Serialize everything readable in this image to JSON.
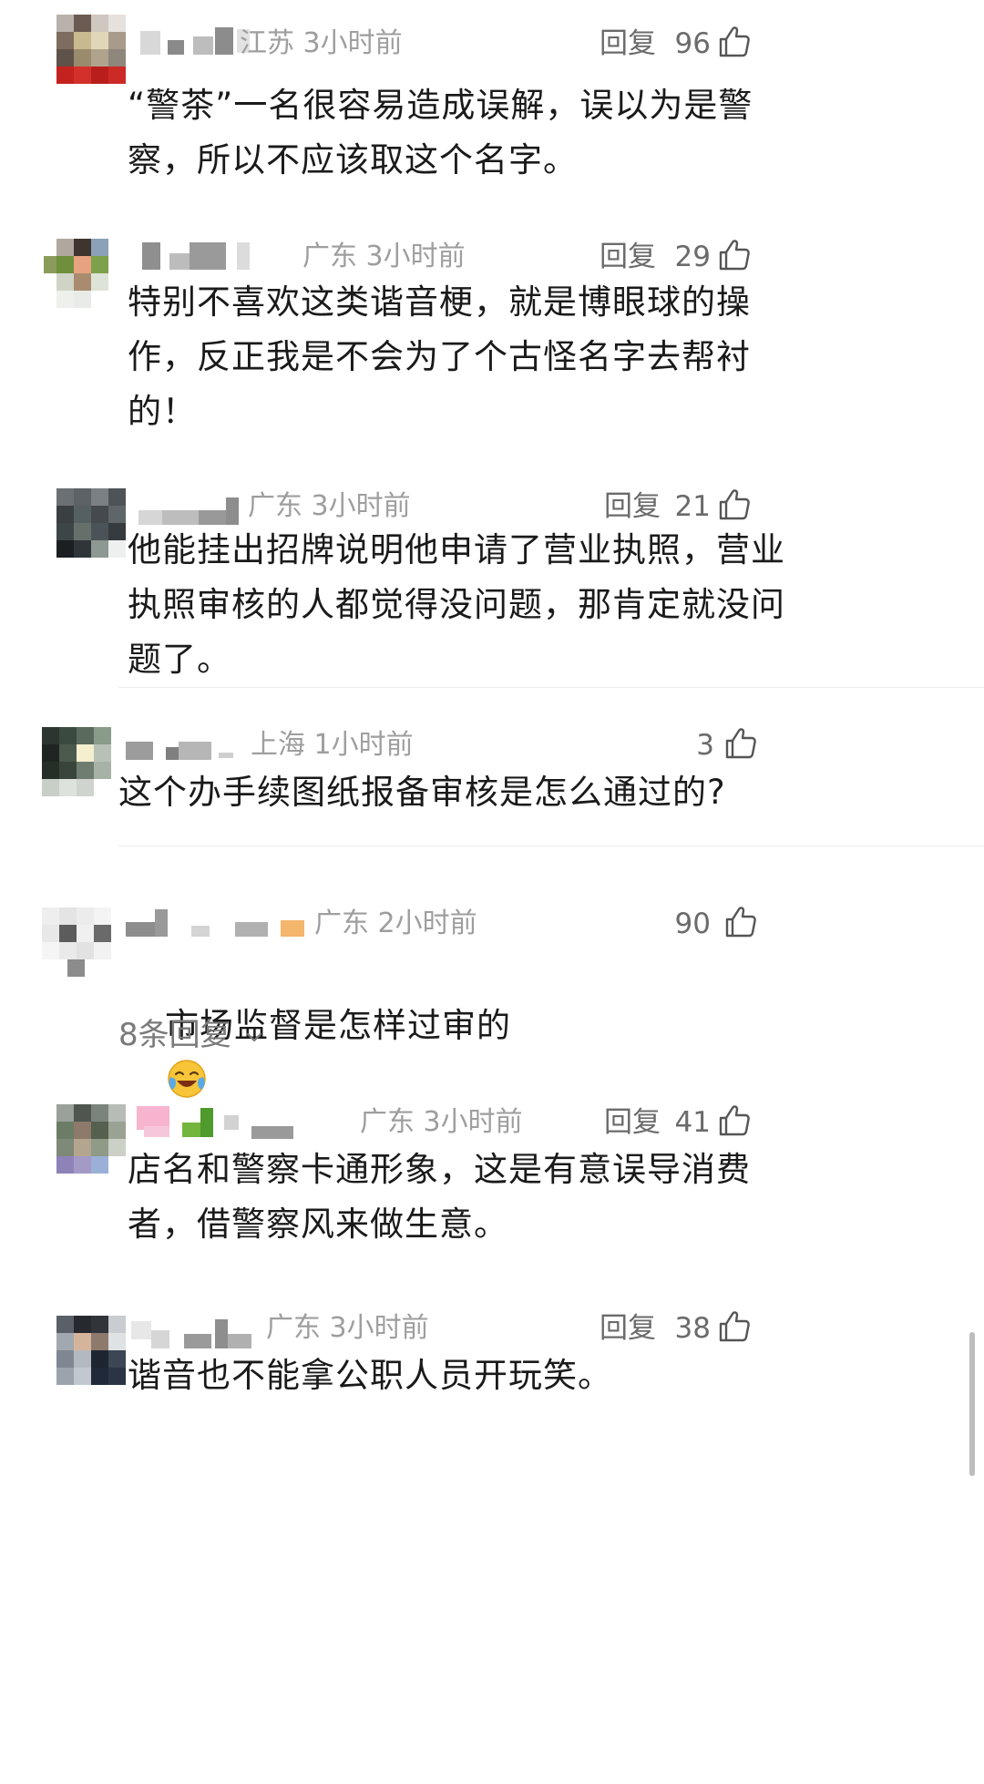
{
  "comments": [
    {
      "location_time": "江苏 3小时前",
      "reply_label": "回复",
      "likes": "96",
      "text": "“警茶”一名很容易造成误解，误以为是警\n察，所以不应该取这个名字。"
    },
    {
      "location_time": "广东 3小时前",
      "reply_label": "回复",
      "likes": "29",
      "text": "特别不喜欢这类谐音梗，就是博眼球的操\n作，反正我是不会为了个古怪名字去帮衬\n的！"
    },
    {
      "location_time": "广东 3小时前",
      "reply_label": "回复",
      "likes": "21",
      "text": "他能挂出招牌说明他申请了营业执照，营业\n执照审核的人都觉得没问题，那肯定就没问\n题了。"
    },
    {
      "location_time": "上海 1小时前",
      "likes": "3",
      "text": "这个办手续图纸报备审核是怎么通过的?"
    },
    {
      "location_time": "广东 2小时前",
      "likes": "90",
      "text": "市场监督是怎样过审的",
      "emoji": "face-with-tears-of-joy",
      "more_replies": "8条回复"
    },
    {
      "location_time": "广东 3小时前",
      "reply_label": "回复",
      "likes": "41",
      "text": "店名和警察卡通形象，这是有意误导消费\n者，借警察风来做生意。"
    },
    {
      "location_time": "广东 3小时前",
      "reply_label": "回复",
      "likes": "38",
      "text": "谐音也不能拿公职人员开玩笑。"
    }
  ],
  "colors": {
    "text": "#1a1a1a",
    "meta": "#9e9e9e",
    "action": "#6b6b6b",
    "divider": "#ececec"
  },
  "icons": {
    "like": "thumbs-up-icon",
    "expand": "chevron-down-icon"
  }
}
